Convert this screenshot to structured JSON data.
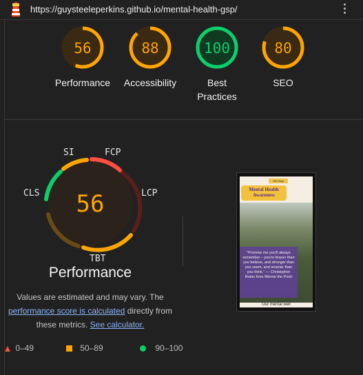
{
  "address_bar": {
    "url": "https://guysteeleperkins.github.io/mental-health-gsp/",
    "icon": "lighthouse-icon",
    "menu_icon": "more-vert-icon"
  },
  "scores": [
    {
      "label": "Performance",
      "value": "56",
      "fraction": 0.56,
      "status": "average"
    },
    {
      "label": "Accessibility",
      "value": "88",
      "fraction": 0.88,
      "status": "average"
    },
    {
      "label": "Best\nPractices",
      "value": "100",
      "fraction": 1.0,
      "status": "pass"
    },
    {
      "label": "SEO",
      "value": "80",
      "fraction": 0.8,
      "status": "average"
    }
  ],
  "performance_detail": {
    "score": "56",
    "title": "Performance",
    "metrics": [
      "SI",
      "FCP",
      "LCP",
      "TBT",
      "CLS"
    ],
    "note_prefix": "Values are estimated and may vary. The ",
    "note_link1": "performance score is calculated",
    "note_middle": " directly from these metrics. ",
    "note_link2": "See calculator."
  },
  "legend": [
    {
      "range": "0–49",
      "color": "#ff4e42",
      "shape": "triangle"
    },
    {
      "range": "50–89",
      "color": "#ffa400",
      "shape": "square"
    },
    {
      "range": "90–100",
      "color": "#0cce6b",
      "shape": "circle"
    }
  ],
  "screenshot": {
    "get_help": "Get Help",
    "banner": "Mental Health Awareness",
    "quote": "\"Promise me you'll always remember – you're braver than you believe, and stronger than you seem, and smarter than you think.\" — Christopher Robin from Winnie the Pooh",
    "bottom_text": "Our mental well"
  },
  "colors": {
    "average": "#ffa400",
    "pass": "#0cce6b",
    "fail": "#ff4e42",
    "background": "#212121"
  }
}
